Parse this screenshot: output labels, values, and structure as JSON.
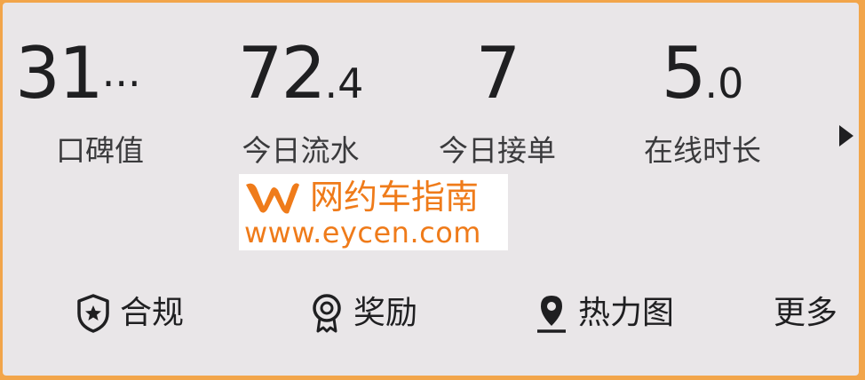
{
  "stats": [
    {
      "value": "31",
      "value_suffix": "···",
      "label": "口碑值"
    },
    {
      "value": "72",
      "value_suffix": ".4",
      "label": "今日流水"
    },
    {
      "value": "7",
      "value_suffix": "",
      "label": "今日接单"
    },
    {
      "value": "5",
      "value_suffix": ".0",
      "label": "在线时长"
    }
  ],
  "next_icon": "triangle-right-icon",
  "watermark": {
    "title": "网约车指南",
    "url": "www.eycen.com",
    "color": "#ef7b1a"
  },
  "actions": [
    {
      "label": "合规",
      "icon": "shield-star-icon"
    },
    {
      "label": "奖励",
      "icon": "award-ribbon-icon"
    },
    {
      "label": "热力图",
      "icon": "map-pin-icon"
    },
    {
      "label": "更多",
      "icon": ""
    }
  ],
  "colors": {
    "background": "#e9e6e8",
    "text": "#1f1f21",
    "border": "#f2a54a"
  }
}
